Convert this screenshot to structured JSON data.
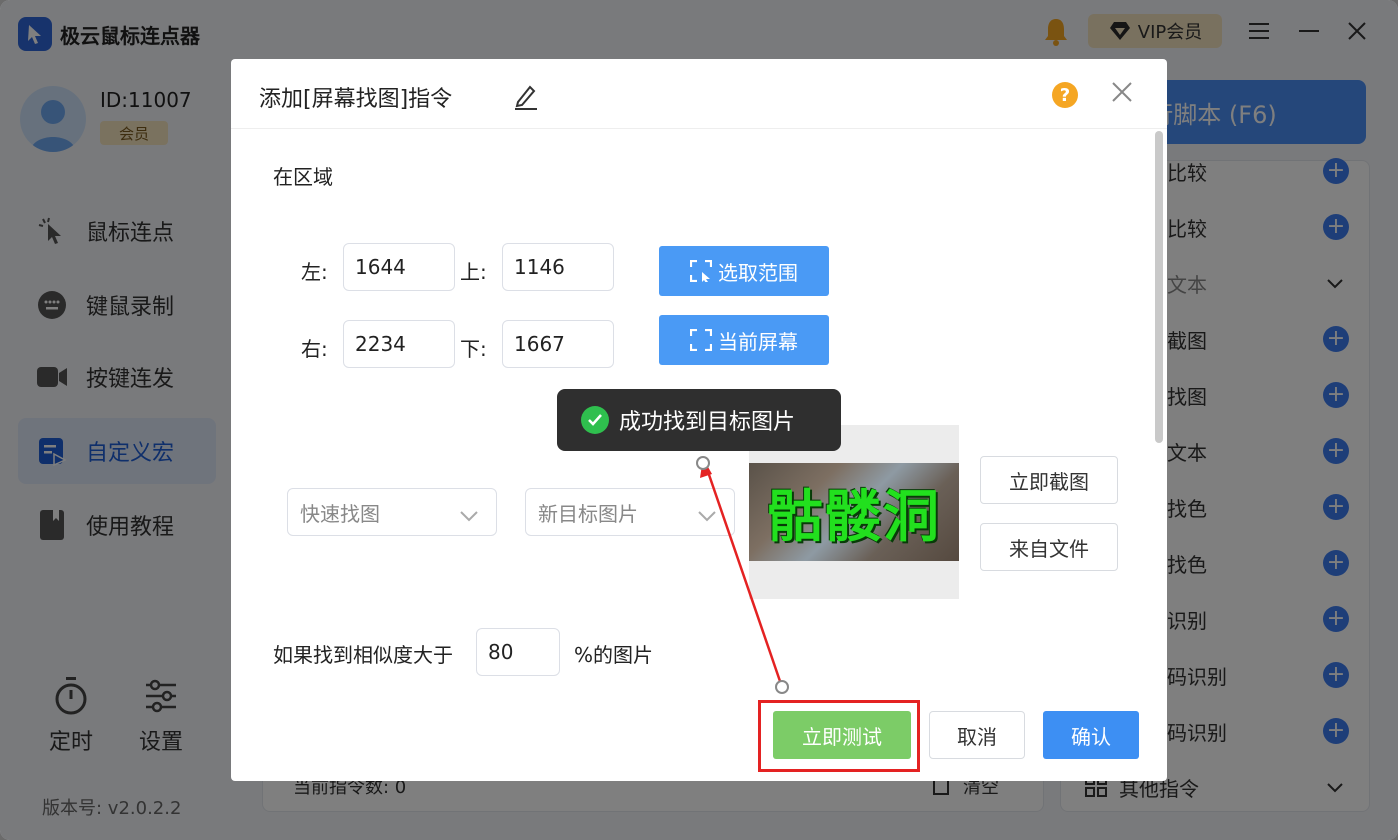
{
  "app": {
    "title": "极云鼠标连点器",
    "vip_label": "VIP会员"
  },
  "user": {
    "id": "ID:11007",
    "badge": "会员"
  },
  "nav": {
    "items": [
      {
        "label": "鼠标连点",
        "icon": "cursor-click-icon"
      },
      {
        "label": "键鼠录制",
        "icon": "keyboard-icon"
      },
      {
        "label": "按键连发",
        "icon": "video-camera-icon"
      },
      {
        "label": "自定义宏",
        "icon": "macro-edit-icon"
      },
      {
        "label": "使用教程",
        "icon": "book-icon"
      }
    ],
    "active": "自定义宏",
    "timer_label": "定时",
    "settings_label": "设置",
    "version": "版本号: v2.0.2.2"
  },
  "main": {
    "run_button": "行脚本 (F6)",
    "command_list": [
      {
        "label": "比较",
        "kind": "add"
      },
      {
        "label": "比较",
        "kind": "add"
      },
      {
        "label": "文本",
        "kind": "group"
      },
      {
        "label": "截图",
        "kind": "add"
      },
      {
        "label": "找图",
        "kind": "add"
      },
      {
        "label": "文本",
        "kind": "add"
      },
      {
        "label": "找色",
        "kind": "add"
      },
      {
        "label": "找色",
        "kind": "add"
      },
      {
        "label": "识别",
        "kind": "add"
      },
      {
        "label": "码识别",
        "kind": "add"
      },
      {
        "label": "码识别",
        "kind": "add"
      },
      {
        "label": "其他指令",
        "kind": "group"
      }
    ],
    "footer_count": "当前指令数: 0",
    "footer_clear": "清空"
  },
  "dialog": {
    "title": "添加[屏幕找图]指令",
    "region_label": "在区域",
    "left_label": "左:",
    "left_value": "1644",
    "top_label": "上:",
    "top_value": "1146",
    "right_label": "右:",
    "right_value": "2234",
    "bottom_label": "下:",
    "bottom_value": "1667",
    "select_range": "选取范围",
    "current_screen": "当前屏幕",
    "mode_select": "快速找图",
    "target_select": "新目标图片",
    "capture_text": "骷髅洞",
    "capture_now": "立即截图",
    "from_file": "来自文件",
    "similarity_prefix": "如果找到相似度大于",
    "similarity_value": "80",
    "similarity_suffix": "%的图片",
    "test_now": "立即测试",
    "cancel": "取消",
    "confirm": "确认"
  },
  "toast": {
    "message": "成功找到目标图片"
  },
  "colors": {
    "primary": "#4a9af5",
    "success": "#7ccc67",
    "highlight": "#e42222",
    "vip_gold": "#f3e2bf"
  }
}
